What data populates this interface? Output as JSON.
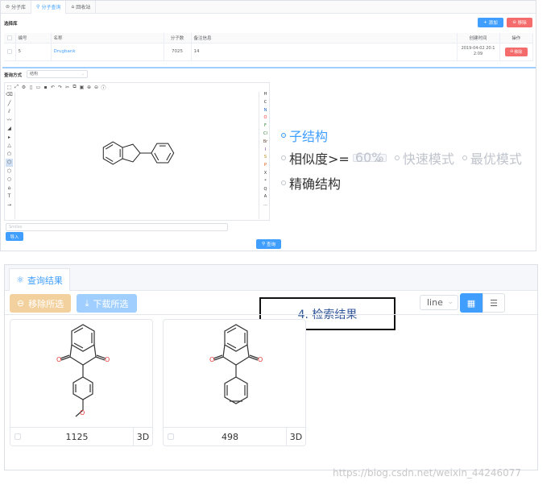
{
  "tabs": [
    {
      "label": "分子库",
      "icon": "database-icon"
    },
    {
      "label": "分子查询",
      "icon": "search-icon",
      "active": true
    },
    {
      "label": "回收站",
      "icon": "trash-icon"
    }
  ],
  "library": {
    "title": "选择库",
    "add_label": "添加",
    "remove_label": "移除",
    "columns": [
      "编号",
      "名称",
      "分子数",
      "备注信息",
      "创建时间",
      "操作"
    ],
    "rows": [
      {
        "id": "5",
        "name": "Drugbank",
        "count": "7025",
        "note": "14",
        "created": "2019-04-02 20:1 2:09",
        "action": "移除"
      }
    ]
  },
  "query": {
    "method_label": "查询方式",
    "method_value": "结构",
    "options": {
      "substructure": "子结构",
      "similarity": "相似度>=",
      "similarity_value": "60%",
      "fast_mode": "快速模式",
      "best_mode": "最优模式",
      "exact": "精确结构"
    },
    "smiles_placeholder": "Smiles",
    "import_label": "导入",
    "query_label": "查询"
  },
  "editor": {
    "right_atoms": [
      "H",
      "C",
      "N",
      "O",
      "F",
      "Cl",
      "Br",
      "I",
      "S",
      "P",
      "X",
      "*",
      "Q",
      "A",
      "..."
    ]
  },
  "results": {
    "tab_label": "查询结果",
    "remove_selected": "移除所选",
    "download_selected": "下载所选",
    "callout": "4. 检索结果",
    "view_select": "line",
    "cards": [
      {
        "value": "1125",
        "label_3d": "3D"
      },
      {
        "value": "498",
        "label_3d": "3D"
      }
    ]
  },
  "watermark": "https://blog.csdn.net/weixin_44246077",
  "colors": {
    "primary": "#409eff",
    "danger": "#f56c6c",
    "warning_light": "#f3d19e",
    "primary_light": "#a0cfff"
  }
}
